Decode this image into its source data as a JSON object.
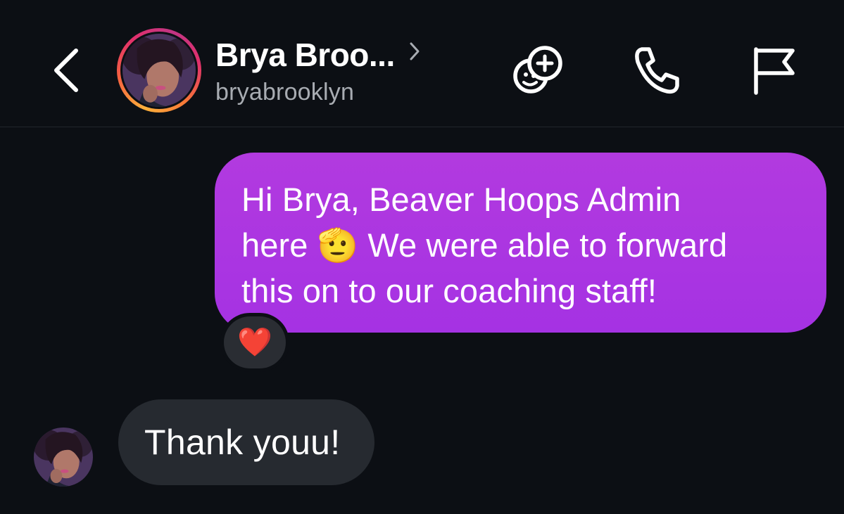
{
  "header": {
    "display_name": "Brya Broo...",
    "username": "bryabrooklyn",
    "icons": {
      "back": "chevron-left-icon",
      "profile_link": "chevron-right-icon",
      "effects": "add-effects-icon",
      "call": "phone-icon",
      "report": "flag-icon"
    },
    "story_ring_colors": [
      "#fbb03b",
      "#f56040",
      "#e1306c",
      "#c13584"
    ]
  },
  "messages": [
    {
      "direction": "outgoing",
      "lines": [
        "Hi Brya, Beaver Hoops Admin",
        "here 🫡 We were able to forward",
        "this on to our coaching staff!"
      ],
      "reaction": "❤️",
      "bubble_color": "#ae37e0"
    },
    {
      "direction": "incoming",
      "text": "Thank youu!",
      "bubble_color": "#262a30"
    }
  ],
  "theme": {
    "background": "#0c0f14",
    "secondary_text": "#a8acb2"
  }
}
